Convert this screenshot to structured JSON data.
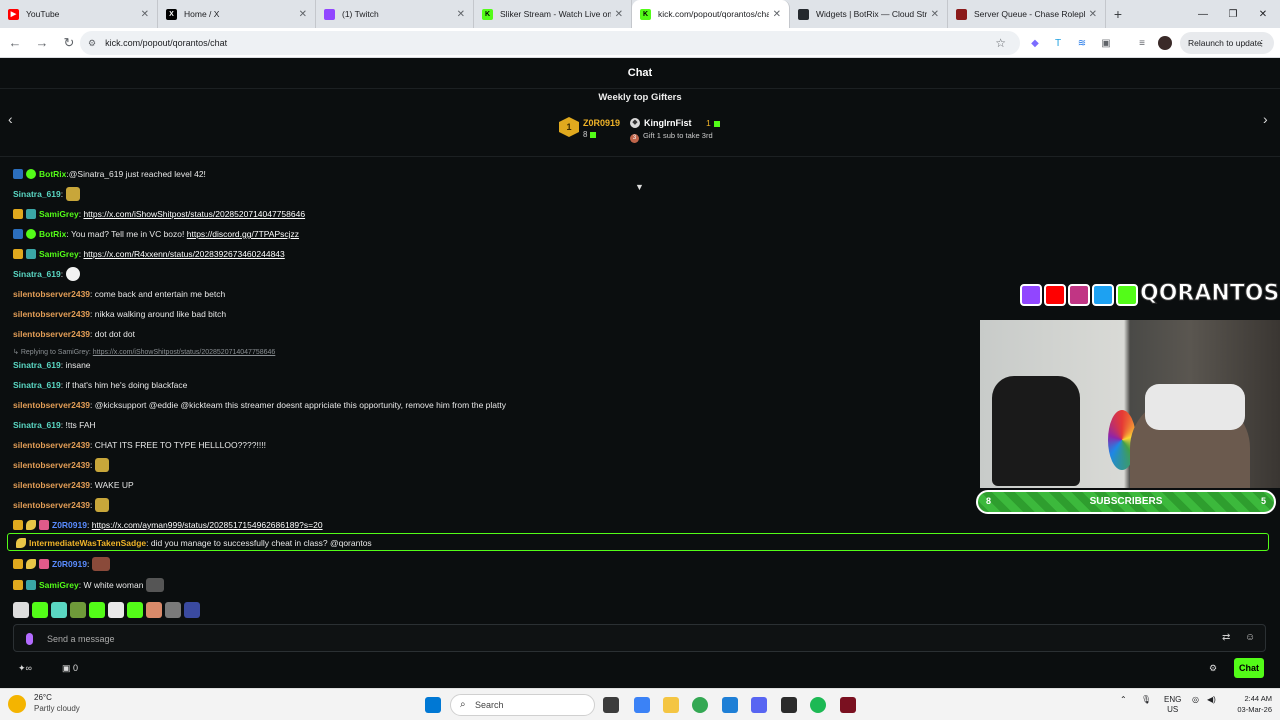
{
  "browser": {
    "tabs": [
      {
        "title": "YouTube",
        "color": "#ff0000"
      },
      {
        "title": "Home / X",
        "color": "#000000"
      },
      {
        "title": "(1) Twitch",
        "color": "#9146ff"
      },
      {
        "title": "Sliker Stream - Watch Live on K",
        "color": "#53fc18"
      },
      {
        "title": "kick.com/popout/qorantos/cha",
        "color": "#53fc18"
      },
      {
        "title": "Widgets | BotRix — Cloud Strea",
        "color": "#24292e"
      },
      {
        "title": "Server Queue - Chase Roleplay",
        "color": "#8b1a1a"
      }
    ],
    "url": "kick.com/popout/qorantos/chat",
    "relaunch_label": "Relaunch to update"
  },
  "chat": {
    "title": "Chat",
    "gifters_title": "Weekly top Gifters",
    "gifter1": {
      "rank": "1",
      "name": "Z0R0919",
      "count": "8"
    },
    "gifter2": {
      "name": "KingIrnFist",
      "count": "1",
      "hint": "Gift 1 sub to take 3rd"
    },
    "messages": [
      {
        "user": "BotRix",
        "text": " @Sinatra_619 just reached level 42!"
      },
      {
        "user": "Sinatra_619",
        "text": ""
      },
      {
        "user": "SamiGrey",
        "link": "https://x.com/iShowShitpost/status/2028520714047758646"
      },
      {
        "user": "BotRix",
        "text": " You mad? Tell me in VC bozo! ",
        "link": "https://discord.gg/7TPAPscjzz"
      },
      {
        "user": "SamiGrey",
        "link": "https://x.com/R4xxenn/status/2028392673460244843"
      },
      {
        "user": "Sinatra_619",
        "text": ""
      },
      {
        "user": "silentobserver2439",
        "text": " come back and entertain me betch"
      },
      {
        "user": "silentobserver2439",
        "text": " nikka walking around like bad bitch"
      },
      {
        "user": "silentobserver2439",
        "text": " dot dot dot"
      },
      {
        "user": "Sinatra_619",
        "text": " insane"
      },
      {
        "user": "Sinatra_619",
        "text": " if that's him he's doing blackface"
      },
      {
        "user": "silentobserver2439",
        "text": " @kicksupport @eddie @kickteam this streamer doesnt appriciate this opportunity, remove him from the platty"
      },
      {
        "user": "Sinatra_619",
        "text": " !tts FAH"
      },
      {
        "user": "silentobserver2439",
        "text": " CHAT ITS FREE TO TYPE HELLLOO????!!!!"
      },
      {
        "user": "silentobserver2439",
        "text": ""
      },
      {
        "user": "silentobserver2439",
        "text": " WAKE UP"
      },
      {
        "user": "silentobserver2439",
        "text": ""
      },
      {
        "user": "Z0R0919",
        "link": "https://x.com/ayman999/status/2028517154962686189?s=20"
      },
      {
        "user": "IntermediateWasTakenSadge",
        "text": " did you manage to successfully cheat in class? @qorantos"
      },
      {
        "user": "Z0R0919",
        "text": ""
      },
      {
        "user": "SamiGrey",
        "text": " W white woman"
      }
    ],
    "reply": {
      "prefix": "Replying to SamiGrey: ",
      "link": "https://x.com/iShowShitpost/status/2028520714047758646"
    },
    "input_placeholder": "Send a message",
    "footer_count": "0",
    "chat_button": "Chat"
  },
  "overlay": {
    "banner_text": "QORANTOS",
    "subs_left": "8",
    "subs_label": "SUBSCRIBERS",
    "subs_right": "5"
  },
  "taskbar": {
    "temp": "26°C",
    "condition": "Partly cloudy",
    "search_placeholder": "Search",
    "lang": "ENG",
    "region": "US",
    "time": "2:44 AM",
    "date": "03-Mar-26"
  }
}
